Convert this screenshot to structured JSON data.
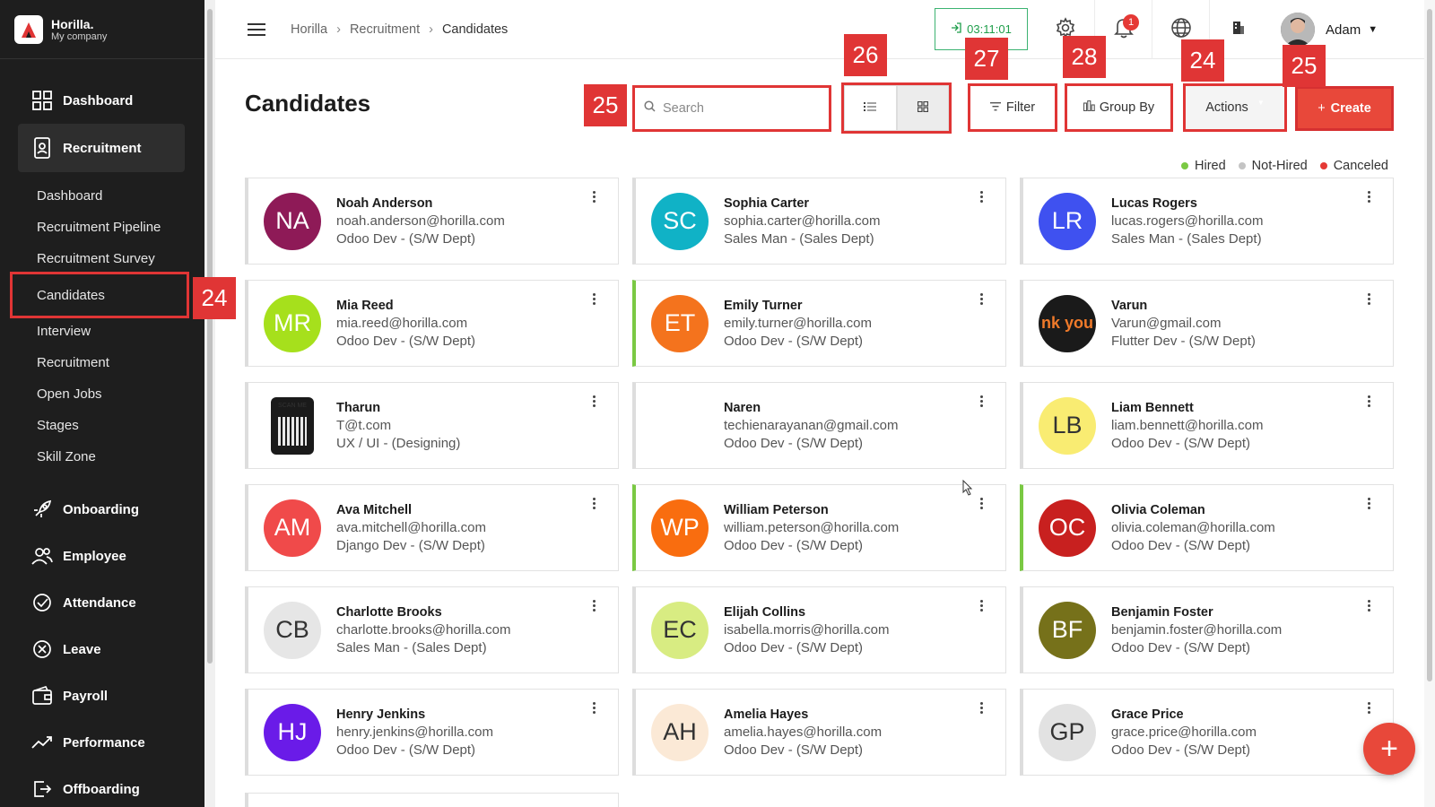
{
  "brand": {
    "name": "Horilla.",
    "company": "My company"
  },
  "sidebar": {
    "main_items": [
      {
        "label": "Dashboard",
        "icon": "dashboard-icon"
      },
      {
        "label": "Recruitment",
        "icon": "recruitment-icon"
      }
    ],
    "sub_items": [
      "Dashboard",
      "Recruitment Pipeline",
      "Recruitment Survey",
      "Candidates",
      "Interview",
      "Recruitment",
      "Open Jobs",
      "Stages",
      "Skill Zone"
    ],
    "bottom_items": [
      {
        "label": "Onboarding",
        "icon": "rocket-icon"
      },
      {
        "label": "Employee",
        "icon": "people-icon"
      },
      {
        "label": "Attendance",
        "icon": "check-circle-icon"
      },
      {
        "label": "Leave",
        "icon": "x-circle-icon"
      },
      {
        "label": "Payroll",
        "icon": "wallet-icon"
      },
      {
        "label": "Performance",
        "icon": "trend-icon"
      },
      {
        "label": "Offboarding",
        "icon": "exit-icon"
      }
    ]
  },
  "header": {
    "breadcrumbs": [
      "Horilla",
      "Recruitment",
      "Candidates"
    ],
    "timer": "03:11:01",
    "notification_count": "1",
    "user_name": "Adam"
  },
  "page": {
    "title": "Candidates",
    "search_placeholder": "Search",
    "filter_label": "Filter",
    "group_by_label": "Group By",
    "actions_label": "Actions",
    "create_label": "Create"
  },
  "markers": {
    "search": "25",
    "view_toggle": "26",
    "filter": "27",
    "group_by": "28",
    "actions": "24",
    "create": "25",
    "candidates_nav": "24"
  },
  "legend": [
    {
      "label": "Hired",
      "color": "#7ac943"
    },
    {
      "label": "Not-Hired",
      "color": "#c4c4c4"
    },
    {
      "label": "Canceled",
      "color": "#e53935"
    }
  ],
  "candidates": [
    {
      "initials": "NA",
      "name": "Noah Anderson",
      "email": "noah.anderson@horilla.com",
      "job": "Odoo Dev - (S/W Dept)",
      "color": "#8e1a57",
      "hired": false
    },
    {
      "initials": "SC",
      "name": "Sophia Carter",
      "email": "sophia.carter@horilla.com",
      "job": "Sales Man - (Sales Dept)",
      "color": "#10b2c6",
      "hired": false
    },
    {
      "initials": "LR",
      "name": "Lucas Rogers",
      "email": "lucas.rogers@horilla.com",
      "job": "Sales Man - (Sales Dept)",
      "color": "#3f51f0",
      "hired": false
    },
    {
      "initials": "MR",
      "name": "Mia Reed",
      "email": "mia.reed@horilla.com",
      "job": "Odoo Dev - (S/W Dept)",
      "color": "#a6e01c",
      "hired": false
    },
    {
      "initials": "ET",
      "name": "Emily Turner",
      "email": "emily.turner@horilla.com",
      "job": "Odoo Dev - (S/W Dept)",
      "color": "#f4731d",
      "hired": true
    },
    {
      "initials": "nk you",
      "name": "Varun",
      "email": "Varun@gmail.com",
      "job": "Flutter Dev - (S/W Dept)",
      "color": "#1a1a1a",
      "hired": false
    },
    {
      "initials": "SCAN ME",
      "name": "Tharun",
      "email": "T@t.com",
      "job": "UX / UI - (Designing)",
      "color": "#ffffff",
      "hired": false
    },
    {
      "initials": "",
      "name": "Naren",
      "email": "techienarayanan@gmail.com",
      "job": "Odoo Dev - (S/W Dept)",
      "color": "#ffffff",
      "hired": false
    },
    {
      "initials": "LB",
      "name": "Liam Bennett",
      "email": "liam.bennett@horilla.com",
      "job": "Odoo Dev - (S/W Dept)",
      "color": "#f9ec72",
      "hired": false
    },
    {
      "initials": "AM",
      "name": "Ava Mitchell",
      "email": "ava.mitchell@horilla.com",
      "job": "Django Dev - (S/W Dept)",
      "color": "#f04a4a",
      "hired": false
    },
    {
      "initials": "WP",
      "name": "William Peterson",
      "email": "william.peterson@horilla.com",
      "job": "Odoo Dev - (S/W Dept)",
      "color": "#f96d0f",
      "hired": true
    },
    {
      "initials": "OC",
      "name": "Olivia Coleman",
      "email": "olivia.coleman@horilla.com",
      "job": "Odoo Dev - (S/W Dept)",
      "color": "#c8201f",
      "hired": true
    },
    {
      "initials": "CB",
      "name": "Charlotte Brooks",
      "email": "charlotte.brooks@horilla.com",
      "job": "Sales Man - (Sales Dept)",
      "color": "#e6e6e6",
      "hired": false
    },
    {
      "initials": "EC",
      "name": "Elijah Collins",
      "email": "isabella.morris@horilla.com",
      "job": "Odoo Dev - (S/W Dept)",
      "color": "#d8ec82",
      "hired": false
    },
    {
      "initials": "BF",
      "name": "Benjamin Foster",
      "email": "benjamin.foster@horilla.com",
      "job": "Odoo Dev - (S/W Dept)",
      "color": "#76711a",
      "hired": false
    },
    {
      "initials": "HJ",
      "name": "Henry Jenkins",
      "email": "henry.jenkins@horilla.com",
      "job": "Odoo Dev - (S/W Dept)",
      "color": "#6a1be8",
      "hired": false
    },
    {
      "initials": "AH",
      "name": "Amelia Hayes",
      "email": "amelia.hayes@horilla.com",
      "job": "Odoo Dev - (S/W Dept)",
      "color": "#fbe9d6",
      "hired": false
    },
    {
      "initials": "GP",
      "name": "Grace Price",
      "email": "grace.price@horilla.com",
      "job": "Odoo Dev - (S/W Dept)",
      "color": "#e2e2e2",
      "hired": false
    }
  ]
}
